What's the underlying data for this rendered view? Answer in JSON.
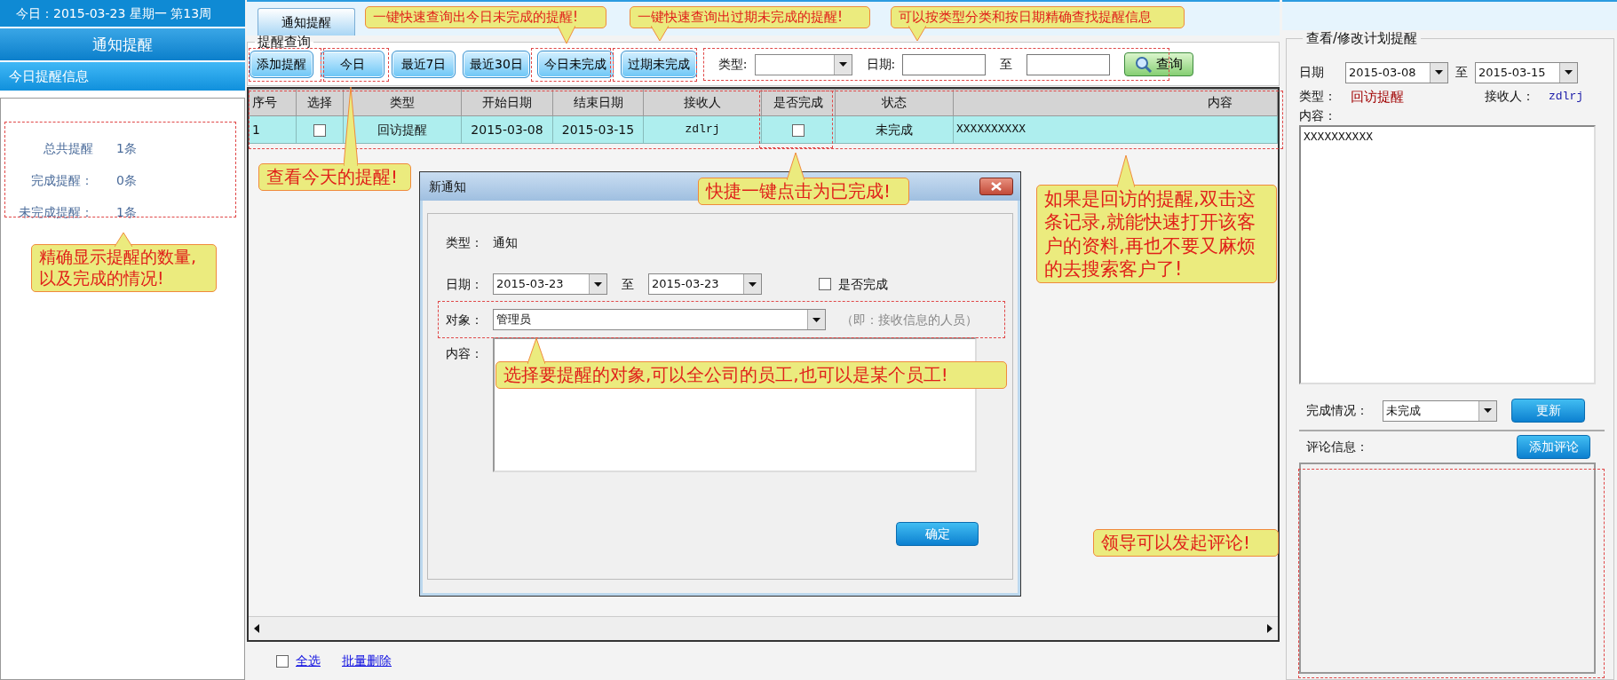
{
  "sidebar": {
    "date_line": "今日：2015-03-23 星期一 第13周",
    "title": "通知提醒",
    "section": "今日提醒信息",
    "stats": [
      {
        "label": "总共提醒",
        "value": "1条"
      },
      {
        "label": "完成提醒：",
        "value": "0条"
      },
      {
        "label": "未完成提醒：",
        "value": "1条"
      }
    ]
  },
  "tabs": [
    {
      "label": "通知提醒",
      "selected": true
    }
  ],
  "query": {
    "legend": "提醒查询",
    "buttons": [
      "添加提醒",
      "今日",
      "最近7日",
      "最近30日",
      "今日未完成",
      "过期未完成"
    ],
    "type_label": "类型:",
    "date_label": "日期:",
    "to_label": "至",
    "search_button": "查询"
  },
  "table": {
    "columns": [
      "序号",
      "选择",
      "类型",
      "开始日期",
      "结束日期",
      "接收人",
      "是否完成",
      "状态",
      "内容"
    ],
    "rows": [
      {
        "index": "1",
        "checked": false,
        "type": "回访提醒",
        "start": "2015-03-08",
        "end": "2015-03-15",
        "recipient": "zdlrj",
        "done": false,
        "status": "未完成",
        "content": "XXXXXXXXXX"
      }
    ]
  },
  "footer": {
    "select_all": {
      "label": "全选",
      "checked": false
    },
    "batch_delete": "批量删除"
  },
  "detail": {
    "legend": "查看/修改计划提醒",
    "date_label": "日期",
    "start": "2015-03-08",
    "to_label": "至",
    "end": "2015-03-15",
    "type_label": "类型：",
    "type_value": "回访提醒",
    "recipient_label": "接收人：",
    "recipient": "zdlrj",
    "content_label": "内容：",
    "content": "XXXXXXXXXX",
    "status_label": "完成情况：",
    "status": "未完成",
    "update_button": "更新",
    "comments_label": "评论信息：",
    "add_comment_button": "添加评论"
  },
  "dialog": {
    "title": "新通知",
    "type_label": "类型：",
    "type_value": "通知",
    "date_label": "日期：",
    "start": "2015-03-23",
    "to_label": "至",
    "end": "2015-03-23",
    "done": {
      "label": "是否完成",
      "checked": false
    },
    "target_label": "对象：",
    "target": "管理员",
    "target_hint": "（即：接收信息的人员）",
    "content_label": "内容：",
    "ok_button": "确定"
  },
  "annotations": [
    {
      "text": "一键快速查询出今日未完成的提醒!",
      "kind": "down"
    },
    {
      "text": "一键快速查询出过期未完成的提醒!",
      "kind": "down"
    },
    {
      "text": "可以按类型分类和按日期精确查找提醒信息",
      "kind": "down"
    },
    {
      "text": "查看今天的提醒!",
      "kind": "up"
    },
    {
      "text": "快捷一键点击为已完成!",
      "kind": "up"
    },
    {
      "text": "如果是回访的提醒,双击这条记录,就能快速打开该客户的资料,再也不要又麻烦的去搜索客户了!",
      "kind": "up"
    },
    {
      "text": "选择要提醒的对象,可以全公司的员工,也可以是某个员工!",
      "kind": "up"
    },
    {
      "text": "精确显示提醒的数量,以及完成的情况!",
      "kind": "up"
    },
    {
      "text": "领导可以发起评论!",
      "kind": "plain"
    }
  ]
}
